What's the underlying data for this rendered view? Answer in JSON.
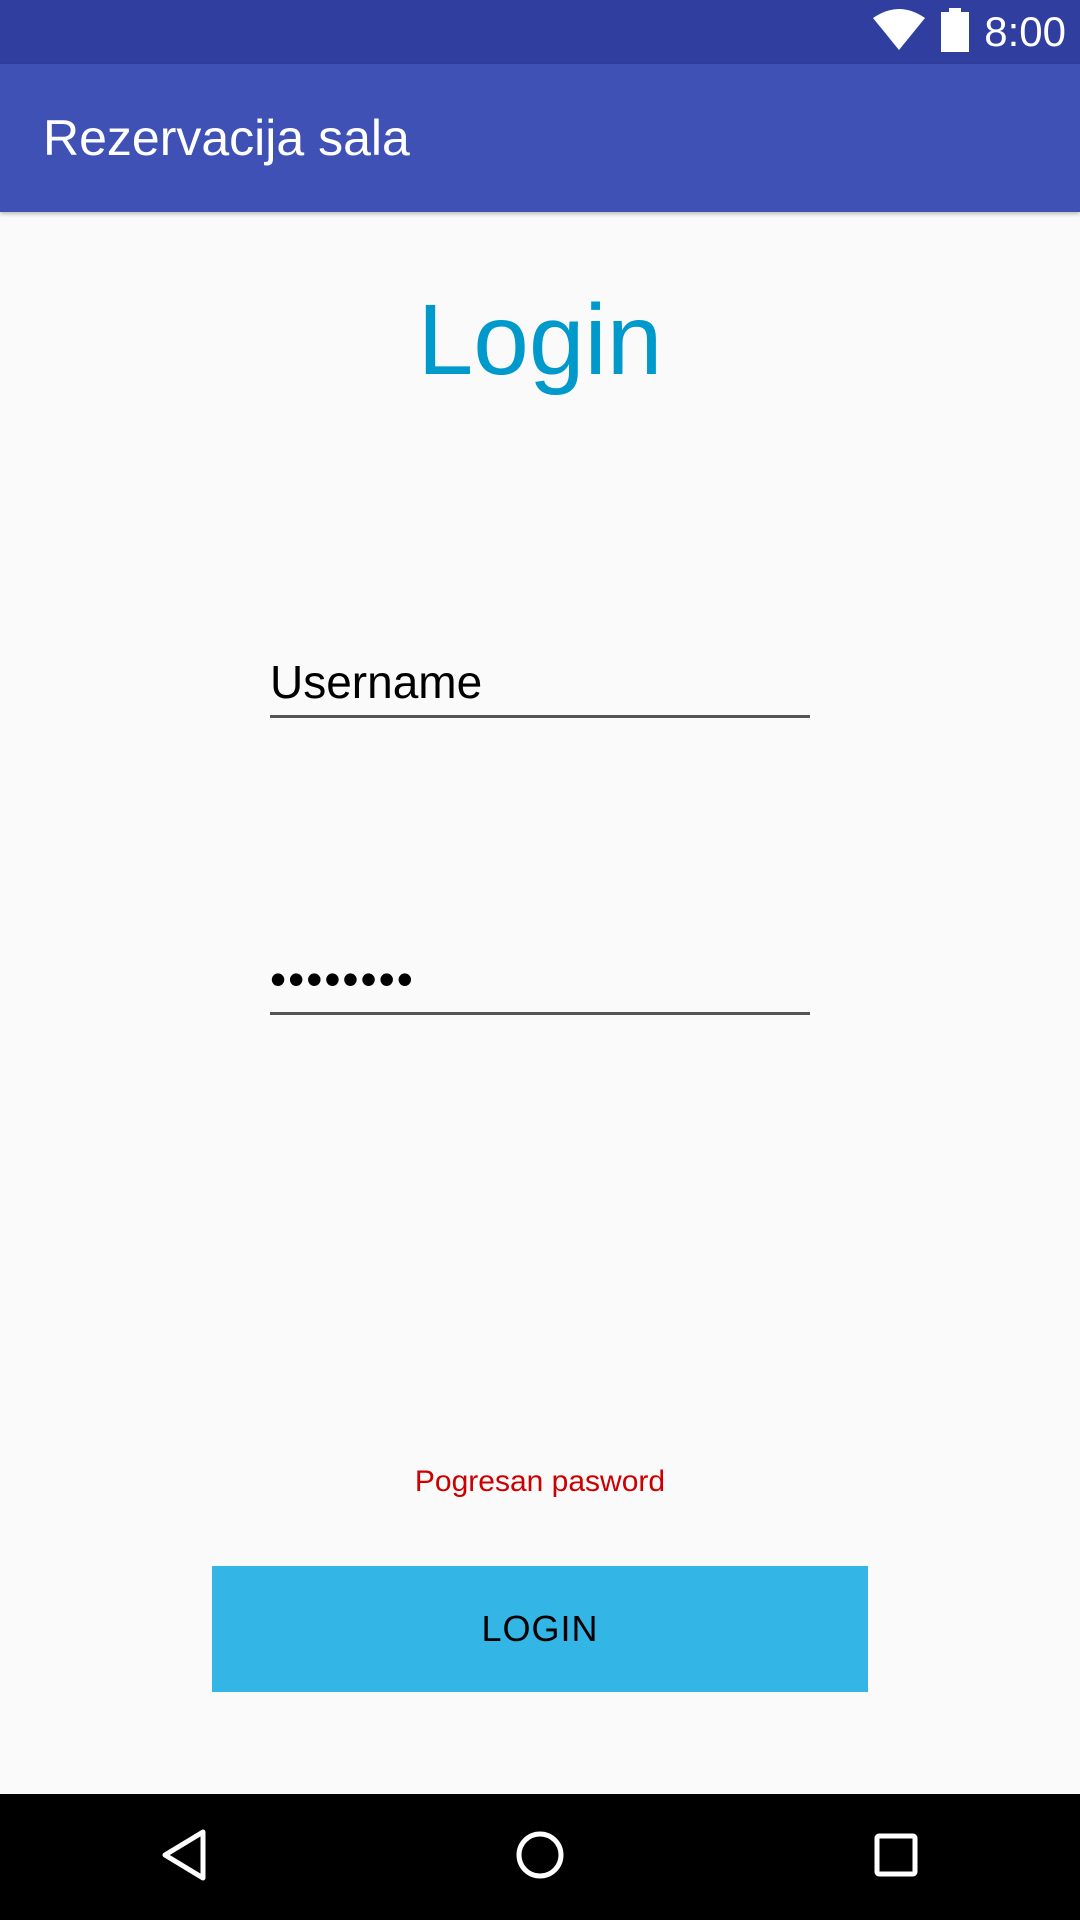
{
  "status_bar": {
    "time": "8:00",
    "icons": [
      "wifi-icon",
      "battery-icon"
    ]
  },
  "app_bar": {
    "title": "Rezervacija sala"
  },
  "login": {
    "heading": "Login",
    "username_placeholder": "Username",
    "password_value": "••••••••",
    "error_message": "Pogresan pasword",
    "button_label": "LOGIN"
  },
  "nav_bar": {
    "icons": [
      "back-icon",
      "home-icon",
      "recents-icon"
    ]
  },
  "colors": {
    "status_bar": "#303f9f",
    "app_bar": "#3f51b5",
    "heading": "#0099cc",
    "error": "#cc0000",
    "button": "#33b5e5"
  }
}
